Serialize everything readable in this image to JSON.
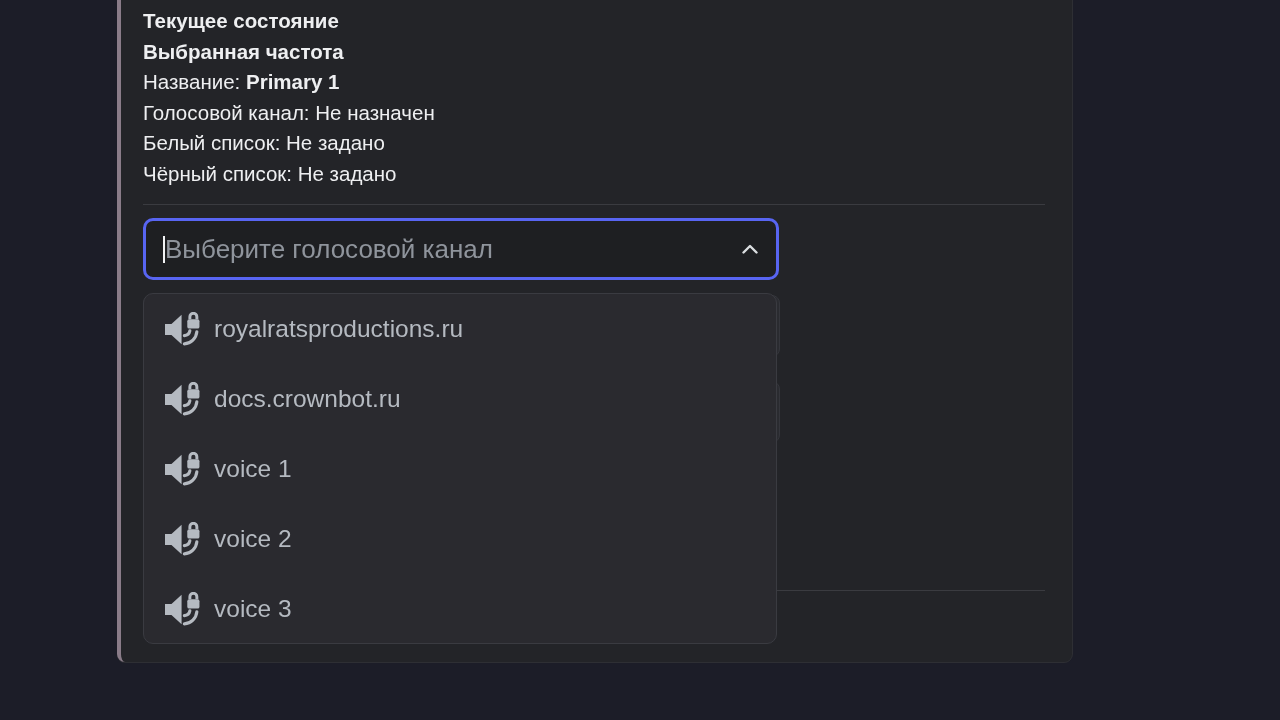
{
  "embed": {
    "lines": [
      {
        "kind": "heading",
        "text": "Текущее состояние"
      },
      {
        "kind": "heading",
        "text": "Выбранная частота"
      },
      {
        "kind": "field",
        "text": "Название: **Primary 1**"
      },
      {
        "kind": "field",
        "text": "Голосовой канал: Не назначен"
      },
      {
        "kind": "field",
        "text": "Белый список: Не задано"
      },
      {
        "kind": "field",
        "text": "Чёрный список: Не задано"
      }
    ]
  },
  "select": {
    "placeholder": "Выберите голосовой канал",
    "expanded": true
  },
  "options": [
    {
      "label": "royalratsproductions.ru"
    },
    {
      "label": "docs.crownbot.ru"
    },
    {
      "label": "voice 1"
    },
    {
      "label": "voice 2"
    },
    {
      "label": "voice 3"
    }
  ]
}
